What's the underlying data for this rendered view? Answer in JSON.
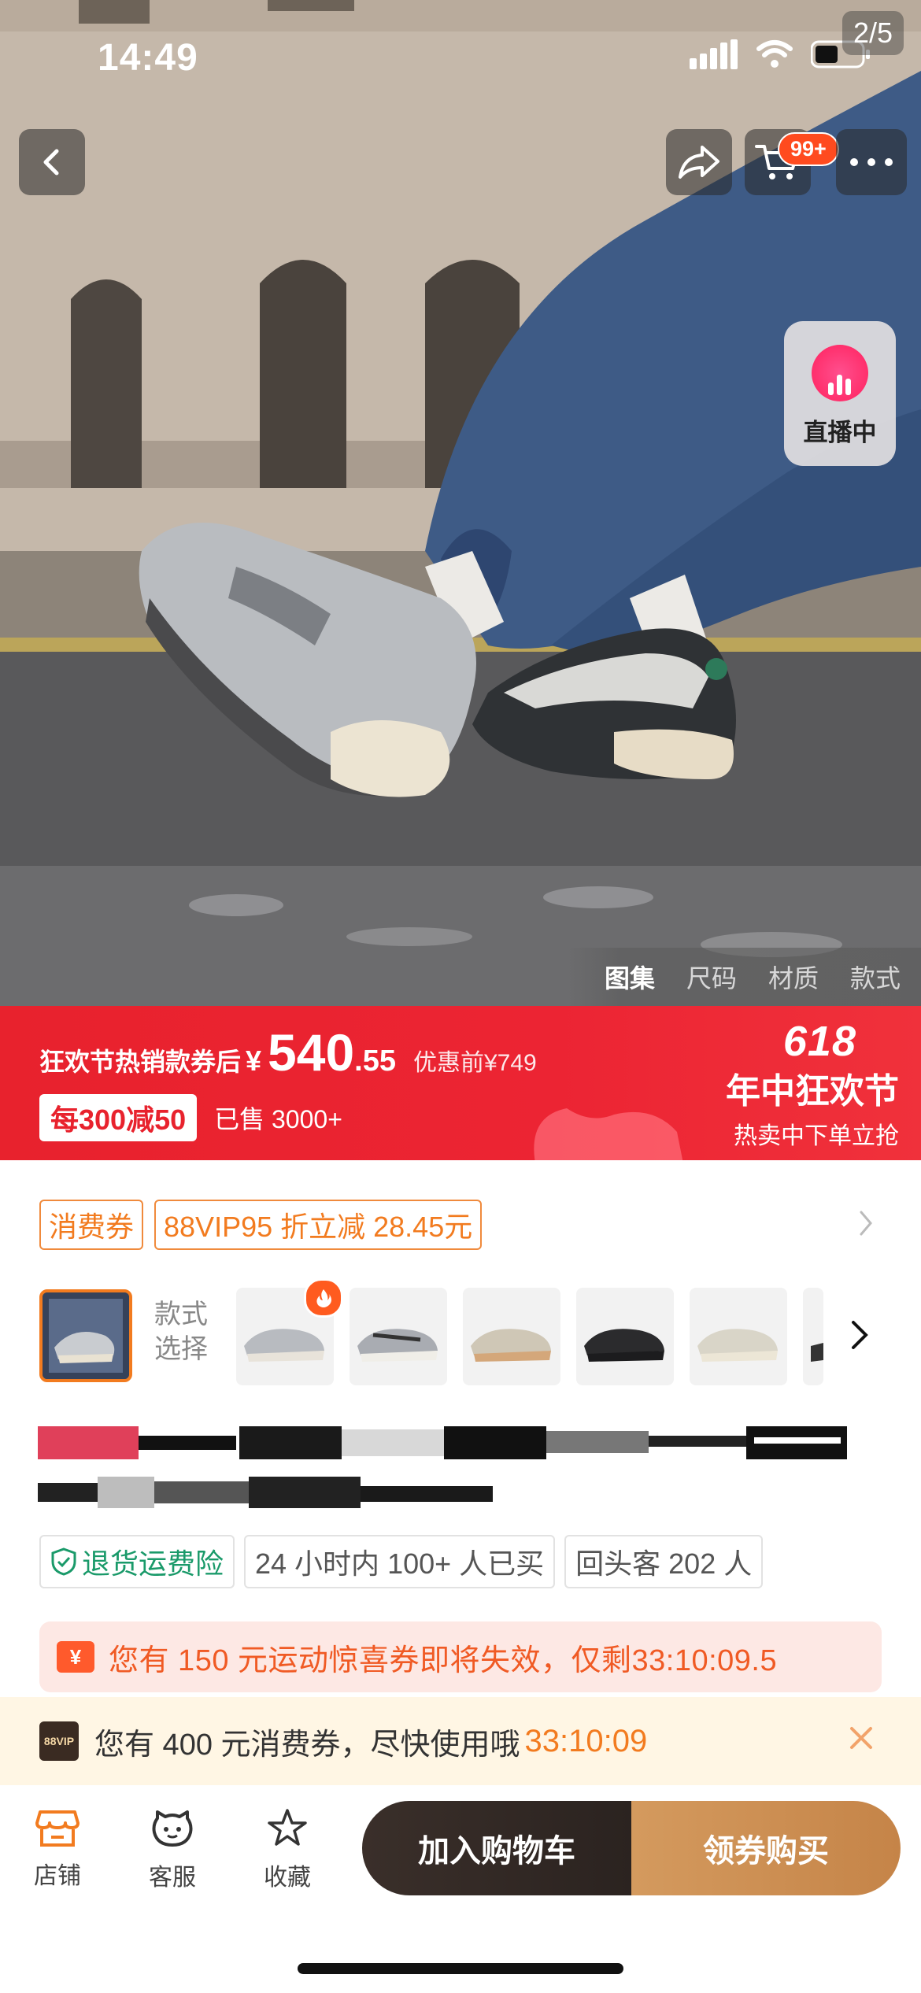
{
  "status_bar": {
    "time": "14:49"
  },
  "gallery": {
    "page_indicator": "2/5",
    "tabs": [
      "图集",
      "尺码",
      "材质",
      "款式"
    ],
    "active_tab": "图集"
  },
  "header": {
    "cart_badge": "99+",
    "live_label": "直播中"
  },
  "promo": {
    "desc": "狂欢节热销款券后",
    "currency": "¥",
    "price_int": "540",
    "price_dec": ".55",
    "original": "优惠前¥749",
    "deal": "每300减50",
    "sold": "已售 3000+",
    "fest_number": "618",
    "fest_title": "年中狂欢节",
    "fest_sub": "热卖中下单立抢"
  },
  "coupons": {
    "tags": [
      "消费券",
      "88VIP95 折立减 28.45元"
    ]
  },
  "style_select": {
    "label": "款式选择"
  },
  "services": {
    "tags": [
      "退货运费险",
      "24 小时内 100+ 人已买",
      "回头客 202 人"
    ]
  },
  "notice": {
    "icon": "¥",
    "text": "您有 150 元运动惊喜券即将失效，仅剩33:10:09.5"
  },
  "vip_bar": {
    "badge": "88VIP",
    "message": "您有 400 元消费券，尽快使用哦",
    "countdown": "33:10:09"
  },
  "bottom_bar": {
    "store": "店铺",
    "service": "客服",
    "favorite": "收藏",
    "add_to_cart": "加入购物车",
    "buy": "领券购买"
  },
  "colors": {
    "promo_red": "#e8222d",
    "accent_orange": "#f27b1f",
    "buy_gold": "#c58448",
    "cart_dark": "#2b2320"
  }
}
